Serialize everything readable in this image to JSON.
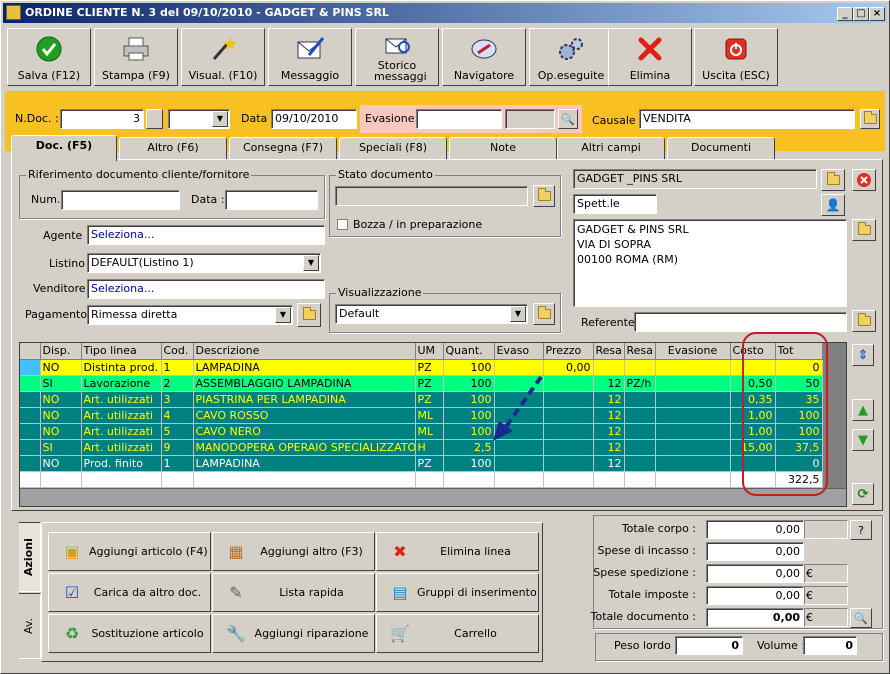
{
  "window": {
    "title": "ORDINE CLIENTE N. 3  del 09/10/2010 - GADGET & PINS SRL",
    "controls": {
      "minimize": "_",
      "maximize": "□",
      "close": "×"
    }
  },
  "toolbar": {
    "buttons": [
      {
        "label": "Salva (F12)",
        "icon": "check-icon"
      },
      {
        "label": "Stampa (F9)",
        "icon": "printer-icon"
      },
      {
        "label": "Visual. (F10)",
        "icon": "magic-wand-icon"
      },
      {
        "label": "Messaggio",
        "icon": "message-icon"
      },
      {
        "label": "Storico messaggi",
        "icon": "message-history-icon"
      },
      {
        "label": "Navigatore",
        "icon": "navigator-icon"
      },
      {
        "label": "Op.eseguite",
        "icon": "gears-icon"
      },
      {
        "label": "Elimina",
        "icon": "delete-x-icon"
      },
      {
        "label": "Uscita (ESC)",
        "icon": "power-icon"
      }
    ]
  },
  "header": {
    "ndoc_label": "N.Doc. :",
    "ndoc_value": "3",
    "data_label": "Data :",
    "data_value": "09/10/2010",
    "evasione_label": "Evasione:",
    "evasione_value": "",
    "causale_label": "Causale :",
    "causale_value": "VENDITA"
  },
  "tabs": [
    "Doc. (F5)",
    "Altro (F6)",
    "Consegna (F7)",
    "Speciali (F8)",
    "Note",
    "Altri campi",
    "Documenti"
  ],
  "doc": {
    "rif_group_title": "Riferimento documento cliente/fornitore",
    "num_label": "Num.:",
    "num_value": "",
    "data_label": "Data :",
    "data_value": "",
    "stato_group_title": "Stato documento",
    "stato_value": "",
    "bozza_label": "Bozza / in preparazione",
    "agente_label": "Agente :",
    "agente_value": "Seleziona...",
    "listino_label": "Listino :",
    "listino_value": "DEFAULT(Listino 1)",
    "venditore_label": "Venditore :",
    "venditore_value": "Seleziona...",
    "pagamento_label": "Pagamento :",
    "pagamento_value": "Rimessa diretta",
    "visualizzazione_title": "Visualizzazione",
    "visualizzazione_value": "Default",
    "cliente_name": "GADGET _PINS SRL",
    "spett_value": "Spett.le",
    "address_lines": [
      "GADGET & PINS SRL",
      "VIA DI SOPRA",
      "00100 ROMA (RM)"
    ],
    "referente_label": "Referente",
    "referente_value": ""
  },
  "grid": {
    "columns": [
      "Disp.",
      "Tipo linea",
      "Cod.",
      "Descrizione",
      "UM",
      "Quant.",
      "Evaso",
      "Prezzo",
      "Resa",
      "Resa",
      "Evasione",
      "Costo",
      "Tot"
    ],
    "rows": [
      {
        "style": "r-y",
        "cells": [
          "NO",
          "Distinta prod.",
          "1",
          "LAMPADINA",
          "PZ",
          "100",
          "",
          "0,00",
          "",
          "",
          "",
          "",
          "0"
        ]
      },
      {
        "style": "r-g",
        "cells": [
          "SI",
          "Lavorazione",
          "2",
          "ASSEMBLAGGIO LAMPADINA",
          "PZ",
          "100",
          "",
          "",
          "12",
          "PZ/h",
          "",
          "0,50",
          "50"
        ]
      },
      {
        "style": "r-t",
        "cells": [
          "NO",
          "Art. utilizzati",
          "3",
          "PIASTRINA PER LAMPADINA",
          "PZ",
          "100",
          "",
          "",
          "12",
          "",
          "",
          "0,35",
          "35"
        ]
      },
      {
        "style": "r-t",
        "cells": [
          "NO",
          "Art. utilizzati",
          "4",
          "CAVO ROSSO",
          "ML",
          "100",
          "",
          "",
          "12",
          "",
          "",
          "1,00",
          "100"
        ]
      },
      {
        "style": "r-t",
        "cells": [
          "NO",
          "Art. utilizzati",
          "5",
          "CAVO NERO",
          "ML",
          "100",
          "",
          "",
          "12",
          "",
          "",
          "1,00",
          "100"
        ]
      },
      {
        "style": "r-t",
        "cells": [
          "SI",
          "Art. utilizzati",
          "9",
          "MANODOPERA OPERAIO SPECIALIZZATO",
          "H",
          "2,5",
          "",
          "",
          "12",
          "",
          "",
          "15,00",
          "37,5"
        ]
      },
      {
        "style": "r-t2",
        "cells": [
          "NO",
          "Prod. finito",
          "1",
          "LAMPADINA",
          "PZ",
          "100",
          "",
          "",
          "12",
          "",
          "",
          "",
          "0"
        ]
      },
      {
        "style": "r-w",
        "cells": [
          "",
          "",
          "",
          "",
          "",
          "",
          "",
          "",
          "",
          "",
          "",
          "",
          "322,5"
        ]
      }
    ]
  },
  "actions": {
    "vtab_azioni": "Azioni",
    "vtab_av": "Av.",
    "buttons": [
      {
        "label": "Aggiungi articolo (F4)",
        "icon": "add-article-icon"
      },
      {
        "label": "Aggiungi altro (F3)",
        "icon": "add-other-icon"
      },
      {
        "label": "Elimina linea",
        "icon": "delete-line-icon"
      },
      {
        "label": "Carica da altro doc.",
        "icon": "load-doc-icon"
      },
      {
        "label": "Lista rapida",
        "icon": "quick-list-icon"
      },
      {
        "label": "Gruppi di inserimento",
        "icon": "insert-group-icon"
      },
      {
        "label": "Sostituzione articolo",
        "icon": "replace-article-icon"
      },
      {
        "label": "Aggiungi riparazione",
        "icon": "wrench-icon"
      },
      {
        "label": "Carrello",
        "icon": "cart-icon"
      }
    ]
  },
  "totals": {
    "corpo_label": "Totale corpo :",
    "corpo_value": "0,00",
    "incasso_label": "Spese di incasso :",
    "incasso_value": "0,00",
    "spedizione_label": "Spese spedizione :",
    "spedizione_value": "0,00",
    "imposte_label": "Totale imposte :",
    "imposte_value": "0,00",
    "documento_label": "Totale documento :",
    "documento_value": "0,00",
    "currency": "€",
    "help": "?",
    "peso_label": "Peso lordo :",
    "peso_value": "0",
    "volume_label": "Volume :",
    "volume_value": "0"
  }
}
